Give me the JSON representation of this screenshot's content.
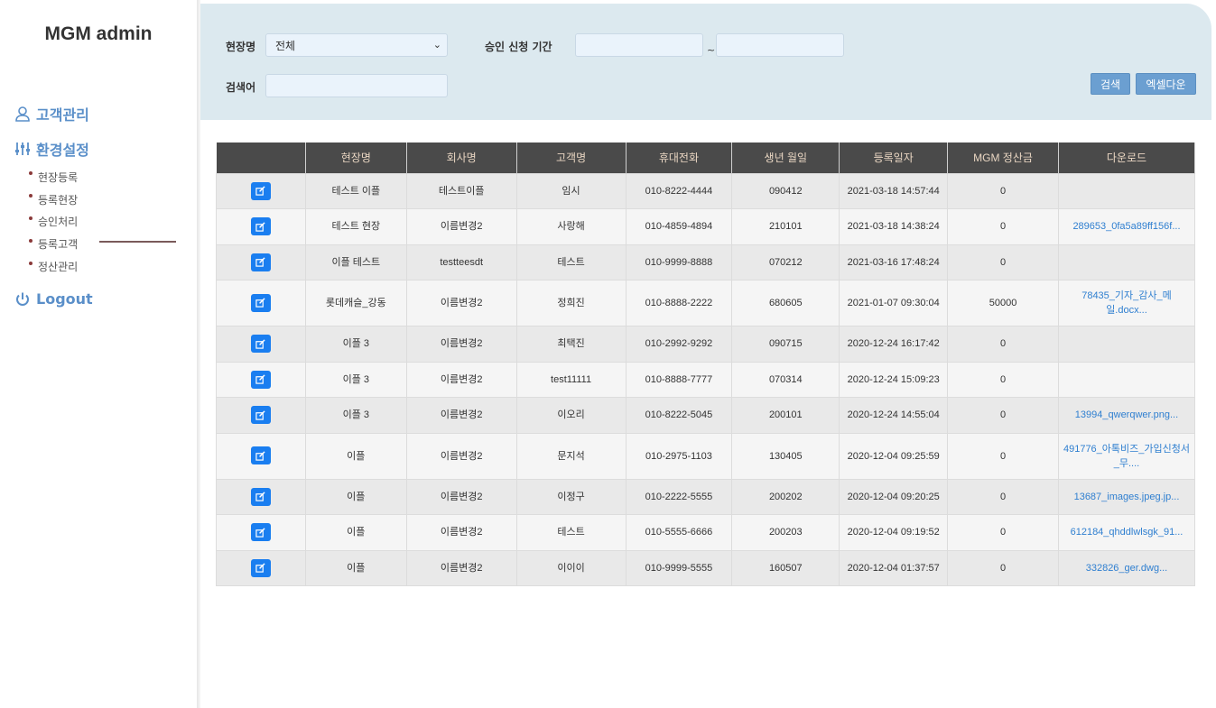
{
  "app": {
    "title": "MGM admin"
  },
  "sidebar": {
    "customer_mgmt": "고객관리",
    "settings": "환경설정",
    "sub_items": [
      "현장등록",
      "등록현장",
      "승인처리",
      "등록고객",
      "정산관리"
    ],
    "logout": "Logout"
  },
  "filters": {
    "site_label": "현장명",
    "site_value": "전체",
    "period_label": "승인 신청 기간",
    "period_from": "",
    "period_to": "",
    "tilde": "~",
    "keyword_label": "검색어",
    "keyword_value": "",
    "search_button": "검색",
    "excel_button": "엑셀다운"
  },
  "table": {
    "headers": [
      "",
      "현장명",
      "회사명",
      "고객명",
      "휴대전화",
      "생년 월일",
      "등록일자",
      "MGM 정산금",
      "다운로드"
    ],
    "rows": [
      {
        "site": "테스트 이플",
        "company": "테스트이플",
        "name": "임시",
        "phone": "010-8222-4444",
        "birth": "090412",
        "date": "2021-03-18 14:57:44",
        "amount": "0",
        "file": ""
      },
      {
        "site": "테스트 현장",
        "company": "이름변경2",
        "name": "사랑해",
        "phone": "010-4859-4894",
        "birth": "210101",
        "date": "2021-03-18 14:38:24",
        "amount": "0",
        "file": "289653_0fa5a89ff156f..."
      },
      {
        "site": "이플 테스트",
        "company": "testteesdt",
        "name": "테스트",
        "phone": "010-9999-8888",
        "birth": "070212",
        "date": "2021-03-16 17:48:24",
        "amount": "0",
        "file": ""
      },
      {
        "site": "롯데캐슬_강동",
        "company": "이름변경2",
        "name": "정희진",
        "phone": "010-8888-2222",
        "birth": "680605",
        "date": "2021-01-07 09:30:04",
        "amount": "50000",
        "file": "78435_기자_감사_메일.docx..."
      },
      {
        "site": "이플 3",
        "company": "이름변경2",
        "name": "최택진",
        "phone": "010-2992-9292",
        "birth": "090715",
        "date": "2020-12-24 16:17:42",
        "amount": "0",
        "file": ""
      },
      {
        "site": "이플 3",
        "company": "이름변경2",
        "name": "test11111",
        "phone": "010-8888-7777",
        "birth": "070314",
        "date": "2020-12-24 15:09:23",
        "amount": "0",
        "file": ""
      },
      {
        "site": "이플 3",
        "company": "이름변경2",
        "name": "이오리",
        "phone": "010-8222-5045",
        "birth": "200101",
        "date": "2020-12-24 14:55:04",
        "amount": "0",
        "file": "13994_qwerqwer.png..."
      },
      {
        "site": "이플",
        "company": "이름변경2",
        "name": "문지석",
        "phone": "010-2975-1103",
        "birth": "130405",
        "date": "2020-12-04 09:25:59",
        "amount": "0",
        "file": "491776_아톡비즈_가입신청서_무...."
      },
      {
        "site": "이플",
        "company": "이름변경2",
        "name": "이정구",
        "phone": "010-2222-5555",
        "birth": "200202",
        "date": "2020-12-04 09:20:25",
        "amount": "0",
        "file": "13687_images.jpeg.jp..."
      },
      {
        "site": "이플",
        "company": "이름변경2",
        "name": "테스트",
        "phone": "010-5555-6666",
        "birth": "200203",
        "date": "2020-12-04 09:19:52",
        "amount": "0",
        "file": "612184_qhddlwlsgk_91..."
      },
      {
        "site": "이플",
        "company": "이름변경2",
        "name": "이이이",
        "phone": "010-9999-5555",
        "birth": "160507",
        "date": "2020-12-04 01:37:57",
        "amount": "0",
        "file": "332826_ger.dwg..."
      }
    ]
  }
}
